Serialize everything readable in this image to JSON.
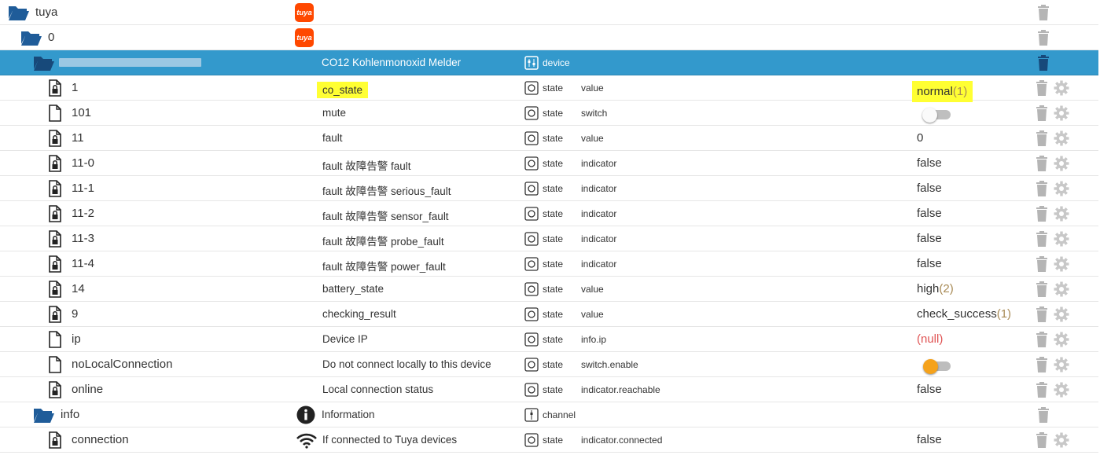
{
  "rows": [
    {
      "id": "tuya",
      "name": "",
      "type": "",
      "role": "",
      "value": ""
    },
    {
      "id": "0",
      "name": "",
      "type": "",
      "role": "",
      "value": ""
    },
    {
      "id": "",
      "name": "CO12 Kohlenmonoxid Melder",
      "type": "device",
      "role": "",
      "value": ""
    },
    {
      "id": "1",
      "name": "co_state",
      "type": "state",
      "role": "value",
      "value": "normal",
      "value_suffix": "(1)"
    },
    {
      "id": "101",
      "name": "mute",
      "type": "state",
      "role": "switch",
      "value": "",
      "toggle": false
    },
    {
      "id": "11",
      "name": "fault",
      "type": "state",
      "role": "value",
      "value": "0"
    },
    {
      "id": "11-0",
      "name": "fault 故障告警 fault",
      "type": "state",
      "role": "indicator",
      "value": "false"
    },
    {
      "id": "11-1",
      "name": "fault 故障告警 serious_fault",
      "type": "state",
      "role": "indicator",
      "value": "false"
    },
    {
      "id": "11-2",
      "name": "fault 故障告警 sensor_fault",
      "type": "state",
      "role": "indicator",
      "value": "false"
    },
    {
      "id": "11-3",
      "name": "fault 故障告警 probe_fault",
      "type": "state",
      "role": "indicator",
      "value": "false"
    },
    {
      "id": "11-4",
      "name": "fault 故障告警 power_fault",
      "type": "state",
      "role": "indicator",
      "value": "false"
    },
    {
      "id": "14",
      "name": "battery_state",
      "type": "state",
      "role": "value",
      "value": "high",
      "value_suffix": "(2)"
    },
    {
      "id": "9",
      "name": "checking_result",
      "type": "state",
      "role": "value",
      "value": "check_success",
      "value_suffix": "(1)"
    },
    {
      "id": "ip",
      "name": "Device IP",
      "type": "state",
      "role": "info.ip",
      "value": "(null)"
    },
    {
      "id": "noLocalConnection",
      "name": "Do not connect locally to this device",
      "type": "state",
      "role": "switch.enable",
      "value": "",
      "toggle": true
    },
    {
      "id": "online",
      "name": "Local connection status",
      "type": "state",
      "role": "indicator.reachable",
      "value": "false"
    },
    {
      "id": "info",
      "name": "Information",
      "type": "channel",
      "role": "",
      "value": ""
    },
    {
      "id": "connection",
      "name": "If connected to Tuya devices",
      "type": "state",
      "role": "indicator.connected",
      "value": "false"
    }
  ],
  "icons": {
    "tuya_logo_text": "tuya"
  },
  "colors": {
    "selected_row": "#3399cc",
    "highlight": "#ffff33",
    "folder": "#1f5c99",
    "null_value": "#e05555",
    "toggle_on": "#f5a21b"
  }
}
